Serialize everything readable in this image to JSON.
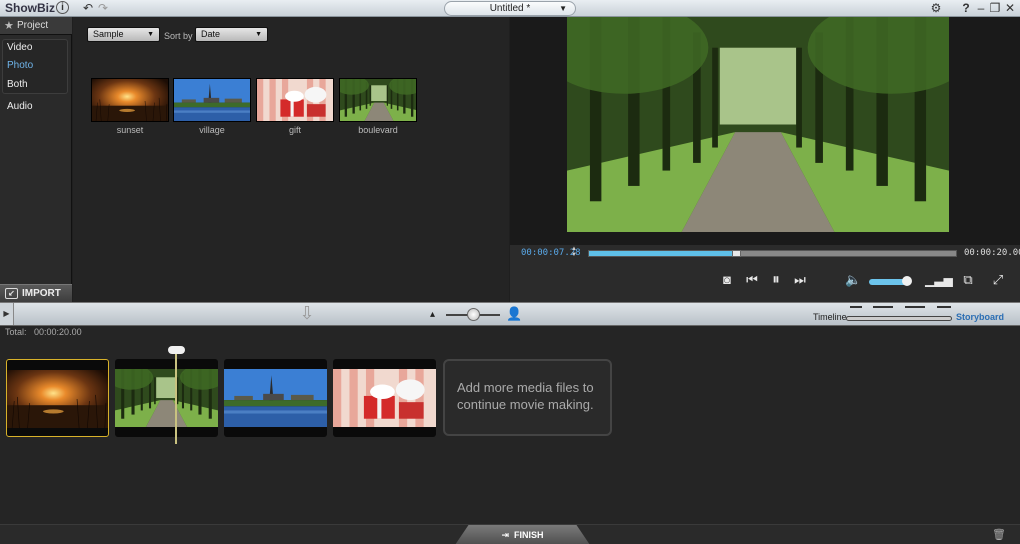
{
  "app": {
    "title": "ShowBiz",
    "info_glyph": "i",
    "document_title": "Untitled *"
  },
  "left_panel": {
    "project_label": "Project",
    "tabs": [
      {
        "label": "Video",
        "selected": false
      },
      {
        "label": "Photo",
        "selected": true
      },
      {
        "label": "Both",
        "selected": false
      },
      {
        "label": "Audio",
        "selected": false
      }
    ],
    "import_label": "IMPORT"
  },
  "library": {
    "source_value": "Sample",
    "sort_label": "Sort by",
    "sort_value": "Date",
    "items": [
      {
        "label": "sunset",
        "image": "sunset"
      },
      {
        "label": "village",
        "image": "village"
      },
      {
        "label": "gift",
        "image": "gift"
      },
      {
        "label": "boulevard",
        "image": "boulevard"
      }
    ]
  },
  "player": {
    "current_time": "00:00:07.28",
    "total_time": "00:00:20.00",
    "progress_fraction": 0.4,
    "volume_fraction": 0.85
  },
  "toolbar": {
    "timeline_label": "Timeline",
    "storyboard_label": "Storyboard",
    "zoom_fraction": 0.5
  },
  "storyboard": {
    "total_label": "Total:",
    "total_time": "00:00:20.00",
    "clips": [
      {
        "image": "sunset",
        "selected": true
      },
      {
        "image": "boulevard",
        "selected": false
      },
      {
        "image": "village",
        "selected": false
      },
      {
        "image": "gift",
        "selected": false
      }
    ],
    "add_more_text": "Add more media files to continue movie making."
  },
  "footer": {
    "finish_label": "FINISH"
  },
  "colors": {
    "accent": "#59a8e8",
    "selected_clip_border": "#d8b22a",
    "storyboard_label": "#2b6eb4"
  }
}
